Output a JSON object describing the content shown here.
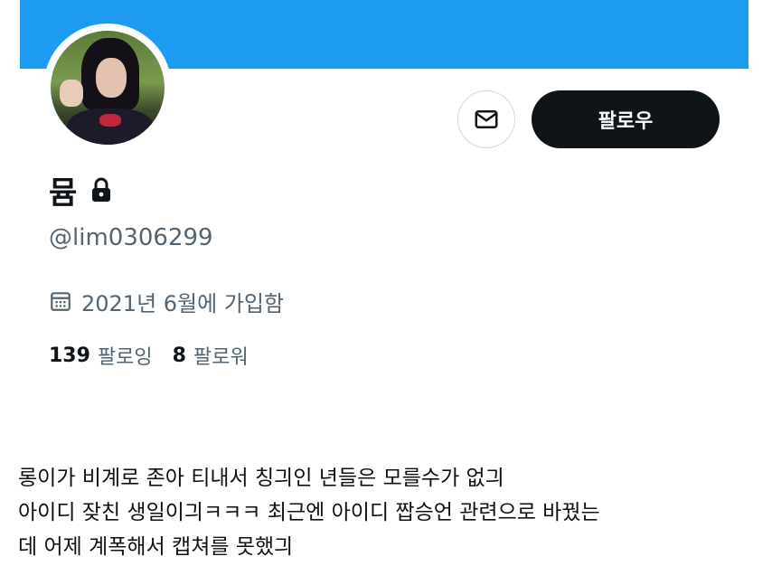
{
  "profile": {
    "display_name": "뮴",
    "handle": "@lim0306299",
    "joined": "2021년 6월에 가입함",
    "following_count": "139",
    "following_label": "팔로잉",
    "followers_count": "8",
    "followers_label": "팔로워"
  },
  "actions": {
    "follow_label": "팔로우"
  },
  "icons": {
    "message": "envelope-icon",
    "lock": "lock-icon",
    "calendar": "calendar-icon"
  },
  "colors": {
    "banner": "#1d9bf0",
    "follow_button": "#0f1419",
    "muted_text": "#536471"
  },
  "caption": {
    "lines": [
      "롱이가 비계로 존아 티내서 칭긔인 년들은 모를수가 없긔",
      "아이디 잦친 생일이긔ㅋㅋㅋ 최근엔 아이디 짭승언 관련으로 바꿨는",
      "데 어제 계폭해서 캡쳐를 못했긔"
    ]
  }
}
